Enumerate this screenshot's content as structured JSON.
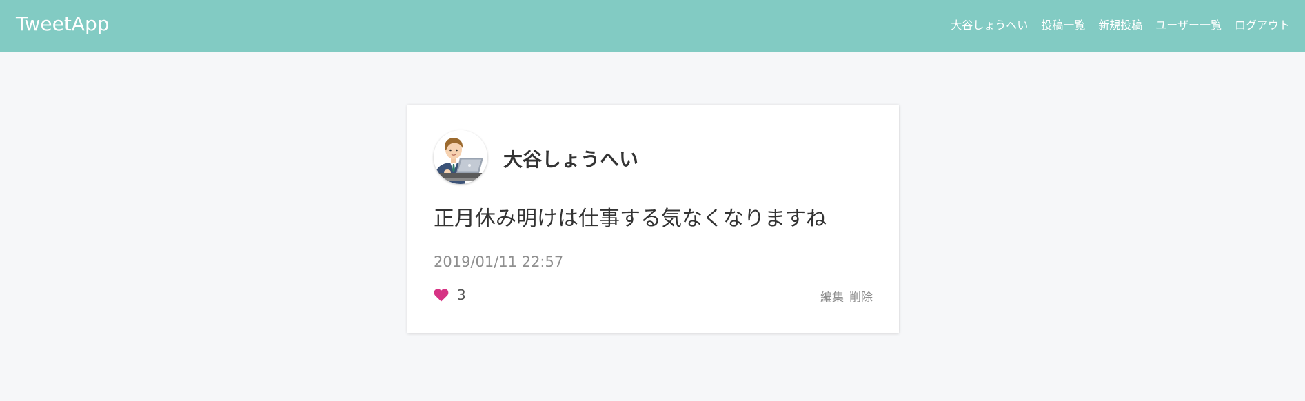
{
  "header": {
    "brand": "TweetApp",
    "nav": [
      {
        "label": "大谷しょうへい"
      },
      {
        "label": "投稿一覧"
      },
      {
        "label": "新規投稿"
      },
      {
        "label": "ユーザー一覧"
      },
      {
        "label": "ログアウト"
      }
    ],
    "background_color": "#82cbc3"
  },
  "post": {
    "avatar_icon": "user-avatar-businessman-laptop",
    "user_name": "大谷しょうへい",
    "content": "正月休み明けは仕事する気なくなりますね",
    "timestamp": "2019/01/11 22:57",
    "like_icon": "heart-icon",
    "like_color": "#d63384",
    "like_count": "3",
    "edit_label": "編集",
    "delete_label": "削除"
  }
}
